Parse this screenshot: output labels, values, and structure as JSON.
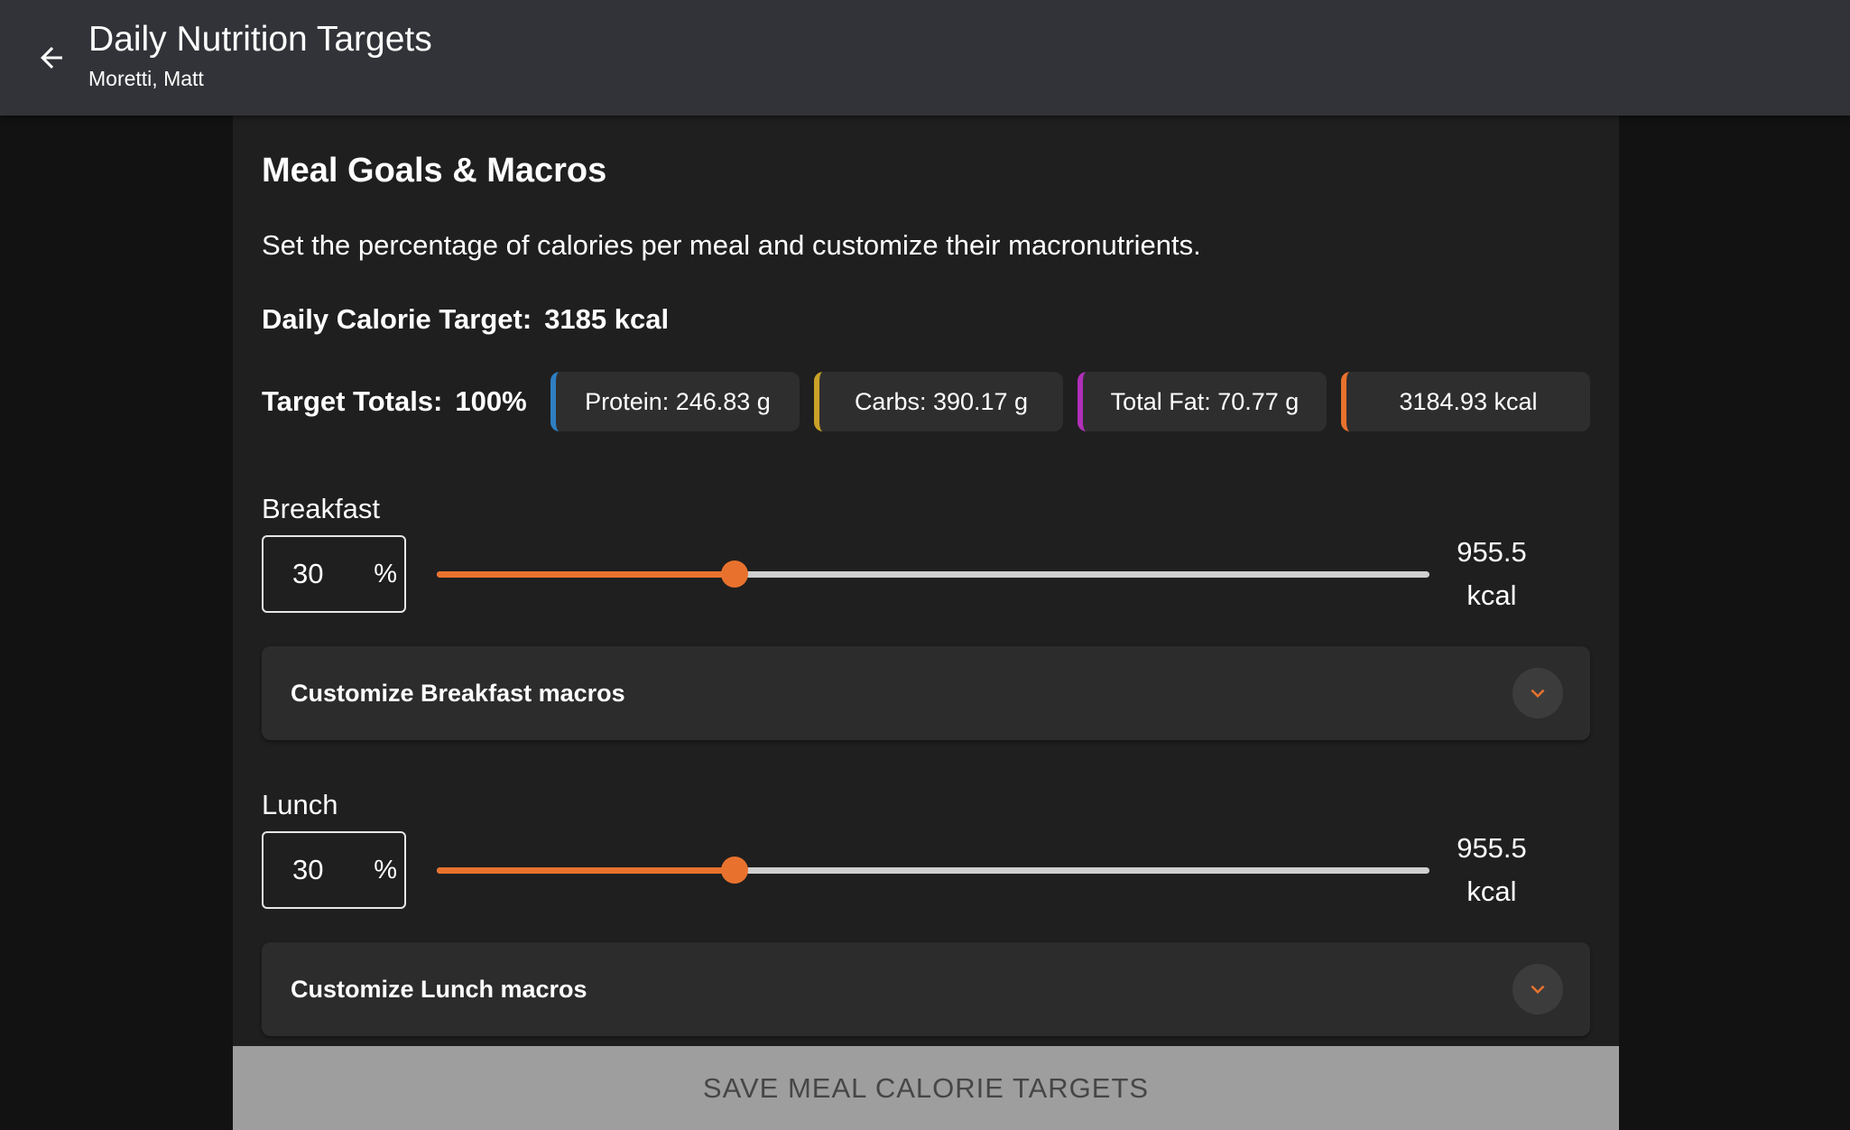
{
  "appbar": {
    "title": "Daily Nutrition Targets",
    "subtitle": "Moretti, Matt",
    "back_icon": "arrow-left-icon"
  },
  "panel": {
    "heading": "Meal Goals & Macros",
    "description": "Set the percentage of calories per meal and customize their macronutrients.",
    "daily_target_label": "Daily Calorie Target:",
    "daily_target_value": "3185 kcal",
    "totals_label": "Target Totals:",
    "totals_value": "100%",
    "chips": [
      {
        "text": "Protein: 246.83 g",
        "color": "#2f7fc0"
      },
      {
        "text": "Carbs: 390.17 g",
        "color": "#c9a227"
      },
      {
        "text": "Total Fat: 70.77 g",
        "color": "#b02fb8"
      },
      {
        "text": "3184.93 kcal",
        "color": "#e8722d"
      }
    ]
  },
  "meals": [
    {
      "name": "Breakfast",
      "percent": "30",
      "unit": "%",
      "slider_value": 30,
      "kcal_value": "955.5",
      "kcal_unit": "kcal",
      "customize_label": "Customize Breakfast macros"
    },
    {
      "name": "Lunch",
      "percent": "30",
      "unit": "%",
      "slider_value": 30,
      "kcal_value": "955.5",
      "kcal_unit": "kcal",
      "customize_label": "Customize Lunch macros"
    }
  ],
  "save_button": "SAVE MEAL CALORIE TARGETS",
  "colors": {
    "accent": "#e8722d",
    "appbar": "#323338",
    "panel": "#1f1f1f"
  }
}
